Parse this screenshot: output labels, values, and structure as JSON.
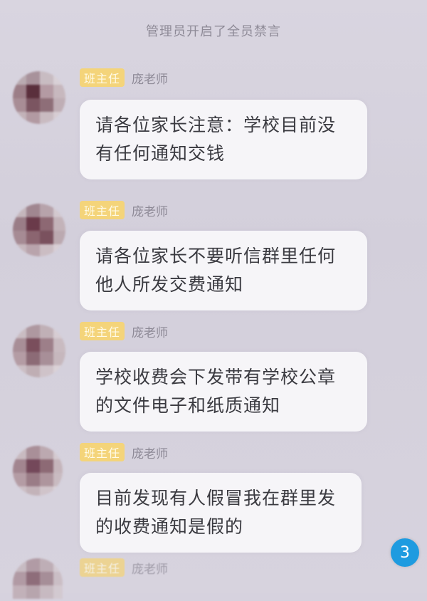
{
  "chat": {
    "system_notice": "管理员开启了全员禁言",
    "messages": [
      {
        "role": "班主任",
        "sender": "庞老师",
        "text": "请各位家长注意：学校目前没有任何通知交钱"
      },
      {
        "role": "班主任",
        "sender": "庞老师",
        "text": "请各位家长不要听信群里任何他人所发交费通知"
      },
      {
        "role": "班主任",
        "sender": "庞老师",
        "text": "学校收费会下发带有学校公章的文件电子和纸质通知"
      },
      {
        "role": "班主任",
        "sender": "庞老师",
        "text": "目前发现有人假冒我在群里发的收费通知是假的"
      },
      {
        "role": "班主任",
        "sender": "庞老师",
        "text": ""
      }
    ],
    "unread_count": "3"
  },
  "colors": {
    "background": "#d6d2de",
    "bubble": "#f6f5f8",
    "role_badge": "#f4d47a",
    "unread_badge": "#1e9be0"
  },
  "icons": {
    "avatar": "pixelated-avatar-icon"
  }
}
